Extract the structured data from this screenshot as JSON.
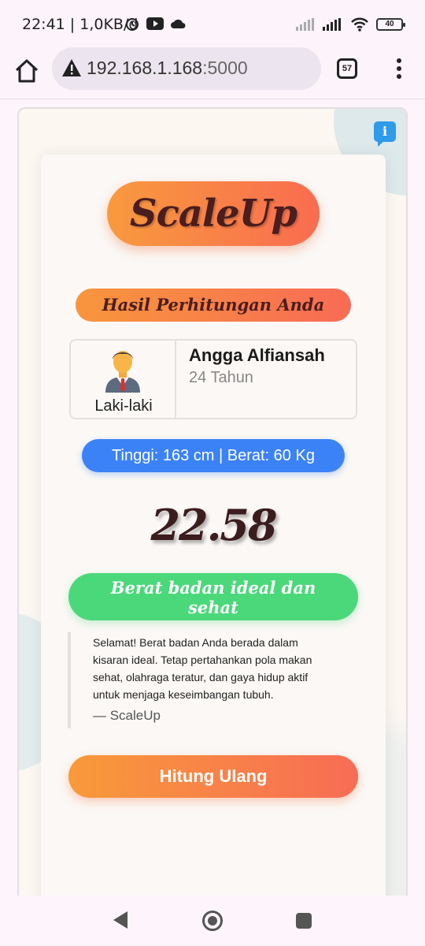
{
  "status_bar": {
    "time_info": "22:41 | 1,0KB/d",
    "battery": "40"
  },
  "browser": {
    "url_host": "192.168.1.168",
    "url_port": ":5000",
    "tab_count": "57"
  },
  "app": {
    "logo": "ScaleUp",
    "result_title": "Hasil Perhitungan Anda",
    "profile": {
      "gender": "Laki-laki",
      "name": "Angga Alfiansah",
      "age": "24 Tahun"
    },
    "measurements": "Tinggi: 163 cm | Berat: 60 Kg",
    "bmi_value": "22.58",
    "status_line1": "Berat badan ideal dan",
    "status_line2": "sehat",
    "quote_text": "Selamat! Berat badan Anda berada dalam kisaran ideal. Tetap pertahankan pola makan sehat, olahraga teratur, dan gaya hidup aktif untuk menjaga keseimbangan tubuh.",
    "quote_source": "— ScaleUp",
    "recalc_button": "Hitung Ulang",
    "info_icon": "i"
  },
  "colors": {
    "accent_orange": "#f89a3e",
    "accent_red": "#f96c50",
    "blue": "#3b82f6",
    "green": "#4bd87a"
  }
}
